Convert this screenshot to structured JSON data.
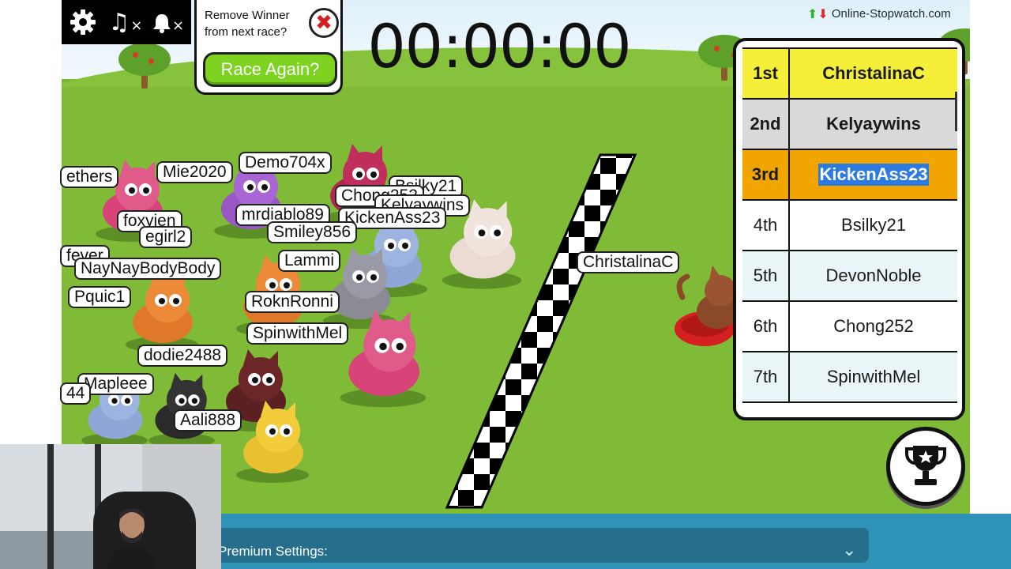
{
  "toolbar": {
    "settings_icon": "gear-icon",
    "music_icon": "music-muted-icon",
    "bell_icon": "bell-muted-icon"
  },
  "winner_panel": {
    "remove_text": "Remove Winner from next race?",
    "race_again_label": "Race Again?"
  },
  "timer": {
    "value": "00:00:00"
  },
  "brand": {
    "name": "Online-Stopwatch.com"
  },
  "leaderboard": {
    "rows": [
      {
        "position": "1st",
        "name": "ChristalinaC"
      },
      {
        "position": "2nd",
        "name": "Kelyaywins"
      },
      {
        "position": "3rd",
        "name": "KickenAss23"
      },
      {
        "position": "4th",
        "name": "Bsilky21"
      },
      {
        "position": "5th",
        "name": "DevonNoble"
      },
      {
        "position": "6th",
        "name": "Chong252"
      },
      {
        "position": "7th",
        "name": "SpinwithMel"
      }
    ],
    "selected": "KickenAss23"
  },
  "racers": {
    "tags": [
      "ethers",
      "Mie2020",
      "Demo704x",
      "Bsilky21",
      "Chong252",
      "Kelyaywins",
      "foxyjen",
      "mrdiablo89",
      "KickenAss23",
      "egirl2",
      "Smiley856",
      "fever",
      "Lammi",
      "NayNayBodyBody",
      "Pquic1",
      "RoknRonni",
      "SpinwithMel",
      "dodie2488",
      "Mapleee",
      "Aali888",
      "44",
      "ChristalinaC"
    ]
  },
  "settings_bar": {
    "label": "Premium Settings:"
  },
  "colors": {
    "grass": "#80bb37",
    "first_place": "#f6ef3a",
    "second_place": "#d9d9d9",
    "third_place": "#f0a500",
    "race_again": "#7ed321",
    "settings_bar": "#2f93b7"
  }
}
